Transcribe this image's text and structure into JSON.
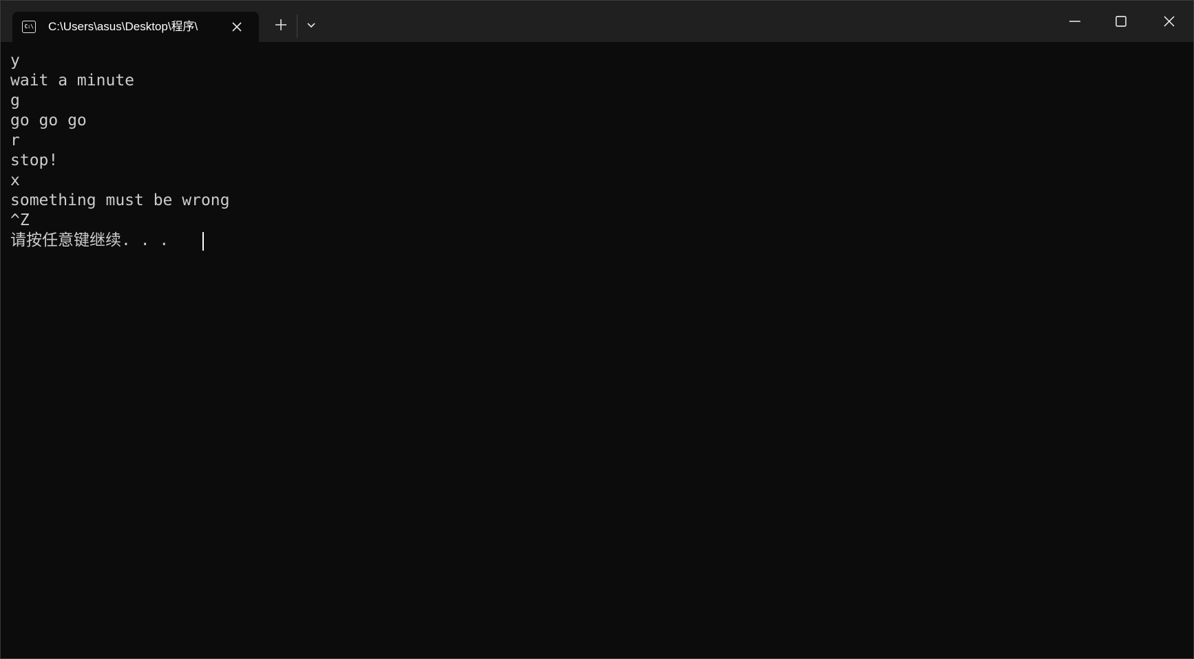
{
  "window": {
    "tab_title": "C:\\Users\\asus\\Desktop\\程序\\",
    "tab_icon": "console-icon",
    "controls": {
      "new_tab": "plus-icon",
      "dropdown": "chevron-down-icon",
      "minimize": "minimize-icon",
      "maximize": "maximize-icon",
      "close": "close-icon"
    }
  },
  "console": {
    "lines": [
      "y",
      "wait a minute",
      "g",
      "go go go",
      "r",
      "stop!",
      "x",
      "something must be wrong",
      "^Z",
      "请按任意键继续. . ."
    ]
  },
  "colors": {
    "background": "#0c0c0c",
    "titlebar": "#202020",
    "text": "#cccccc"
  }
}
